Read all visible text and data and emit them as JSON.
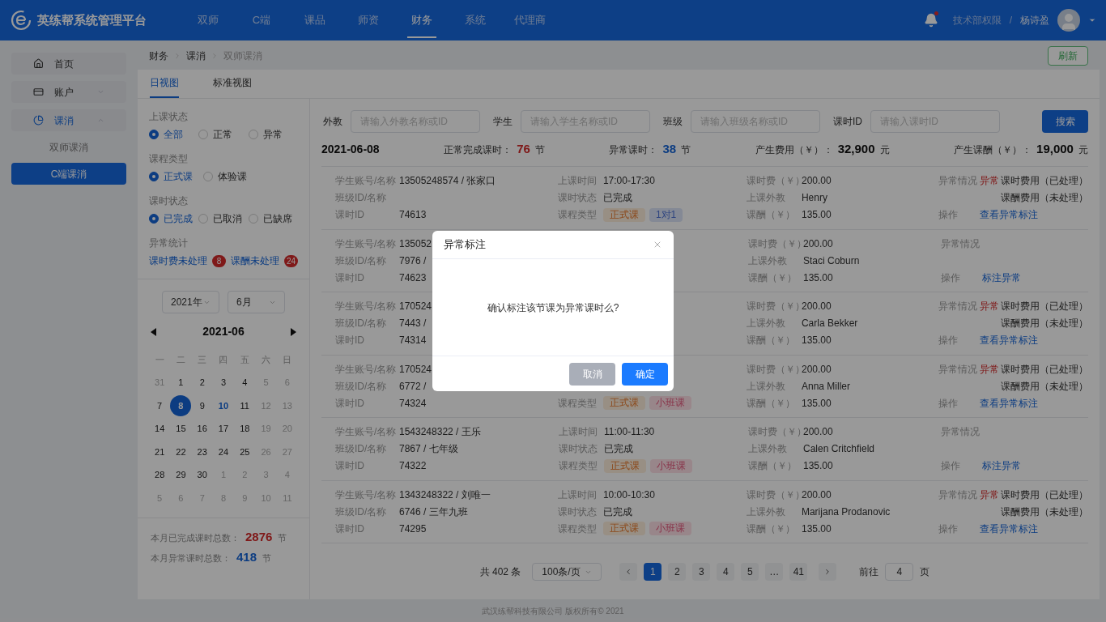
{
  "header": {
    "brand": "英练帮系统管理平台",
    "nav": [
      {
        "label": "双师",
        "selected": false
      },
      {
        "label": "C端",
        "selected": false
      },
      {
        "label": "课品",
        "selected": false
      },
      {
        "label": "师资",
        "selected": false
      },
      {
        "label": "财务",
        "selected": true
      },
      {
        "label": "系统",
        "selected": false
      },
      {
        "label": "代理商",
        "selected": false
      }
    ],
    "notification_dot": true,
    "role": "技术部权限",
    "separator": "/",
    "user": "杨诗盈"
  },
  "sidebar": {
    "items": [
      {
        "label": "首页",
        "selected": false
      },
      {
        "label": "账户",
        "selected": false,
        "expanded": false
      },
      {
        "label": "课消",
        "selected": true,
        "expanded": true,
        "children": [
          {
            "label": "双师课消",
            "selected": false
          },
          {
            "label": "C端课消",
            "selected": true
          }
        ]
      }
    ]
  },
  "breadcrumb": [
    "财务",
    "课消",
    "双师课消"
  ],
  "refresh_button": "刷新",
  "tabs": [
    {
      "label": "日视图",
      "selected": true
    },
    {
      "label": "标准视图",
      "selected": false
    }
  ],
  "filters": [
    {
      "title": "上课状态",
      "options": [
        {
          "label": "全部",
          "selected": true
        },
        {
          "label": "正常",
          "selected": false
        },
        {
          "label": "异常",
          "selected": false
        }
      ]
    },
    {
      "title": "课程类型",
      "options": [
        {
          "label": "正式课",
          "selected": true
        },
        {
          "label": "体验课",
          "selected": false
        }
      ]
    },
    {
      "title": "课时状态",
      "options": [
        {
          "label": "已完成",
          "selected": true
        },
        {
          "label": "已取消",
          "selected": false
        },
        {
          "label": "已缺席",
          "selected": false
        }
      ]
    }
  ],
  "abnormal_stats": {
    "title": "异常统计",
    "links": [
      {
        "label": "课时费未处理",
        "count": "8"
      },
      {
        "label": "课酬未处理",
        "count": "24"
      }
    ]
  },
  "calendar": {
    "year": "2021年",
    "month": "6月",
    "title": "2021-06",
    "weekdays": [
      "一",
      "二",
      "三",
      "四",
      "五",
      "六",
      "日"
    ],
    "days": [
      {
        "d": "31",
        "muted": true,
        "marked": false,
        "selected": false
      },
      {
        "d": "1",
        "muted": false,
        "marked": false,
        "selected": false
      },
      {
        "d": "2",
        "muted": false,
        "marked": false,
        "selected": false
      },
      {
        "d": "3",
        "muted": false,
        "marked": false,
        "selected": false
      },
      {
        "d": "4",
        "muted": false,
        "marked": false,
        "selected": false
      },
      {
        "d": "5",
        "muted": true,
        "marked": false,
        "selected": false
      },
      {
        "d": "6",
        "muted": true,
        "marked": false,
        "selected": false
      },
      {
        "d": "7",
        "muted": false,
        "marked": false,
        "selected": false
      },
      {
        "d": "8",
        "muted": false,
        "marked": false,
        "selected": true
      },
      {
        "d": "9",
        "muted": false,
        "marked": false,
        "selected": false
      },
      {
        "d": "10",
        "muted": false,
        "marked": true,
        "selected": false
      },
      {
        "d": "11",
        "muted": false,
        "marked": false,
        "selected": false
      },
      {
        "d": "12",
        "muted": true,
        "marked": false,
        "selected": false
      },
      {
        "d": "13",
        "muted": true,
        "marked": false,
        "selected": false
      },
      {
        "d": "14",
        "muted": false,
        "marked": false,
        "selected": false
      },
      {
        "d": "15",
        "muted": false,
        "marked": false,
        "selected": false
      },
      {
        "d": "16",
        "muted": false,
        "marked": false,
        "selected": false
      },
      {
        "d": "17",
        "muted": false,
        "marked": false,
        "selected": false
      },
      {
        "d": "18",
        "muted": false,
        "marked": false,
        "selected": false
      },
      {
        "d": "19",
        "muted": true,
        "marked": false,
        "selected": false
      },
      {
        "d": "20",
        "muted": true,
        "marked": false,
        "selected": false
      },
      {
        "d": "21",
        "muted": false,
        "marked": false,
        "selected": false
      },
      {
        "d": "22",
        "muted": false,
        "marked": false,
        "selected": false
      },
      {
        "d": "23",
        "muted": false,
        "marked": false,
        "selected": false
      },
      {
        "d": "24",
        "muted": false,
        "marked": false,
        "selected": false
      },
      {
        "d": "25",
        "muted": false,
        "marked": false,
        "selected": false
      },
      {
        "d": "26",
        "muted": true,
        "marked": false,
        "selected": false
      },
      {
        "d": "27",
        "muted": true,
        "marked": false,
        "selected": false
      },
      {
        "d": "28",
        "muted": false,
        "marked": false,
        "selected": false
      },
      {
        "d": "29",
        "muted": false,
        "marked": false,
        "selected": false
      },
      {
        "d": "30",
        "muted": false,
        "marked": false,
        "selected": false
      },
      {
        "d": "1",
        "muted": true,
        "marked": false,
        "selected": false
      },
      {
        "d": "2",
        "muted": true,
        "marked": false,
        "selected": false
      },
      {
        "d": "3",
        "muted": true,
        "marked": false,
        "selected": false
      },
      {
        "d": "4",
        "muted": true,
        "marked": false,
        "selected": false
      },
      {
        "d": "5",
        "muted": true,
        "marked": false,
        "selected": false
      },
      {
        "d": "6",
        "muted": true,
        "marked": false,
        "selected": false
      },
      {
        "d": "7",
        "muted": true,
        "marked": false,
        "selected": false
      },
      {
        "d": "8",
        "muted": true,
        "marked": false,
        "selected": false
      },
      {
        "d": "9",
        "muted": true,
        "marked": false,
        "selected": false
      },
      {
        "d": "10",
        "muted": true,
        "marked": false,
        "selected": false
      },
      {
        "d": "11",
        "muted": true,
        "marked": false,
        "selected": false
      }
    ]
  },
  "month_stats": [
    {
      "label": "本月已完成课时总数：",
      "value": "2876",
      "unit": "节",
      "kind": "completed"
    },
    {
      "label": "本月异常课时总数：",
      "value": "418",
      "unit": "节",
      "kind": "abnormal"
    }
  ],
  "search": {
    "fields": [
      {
        "label": "外教",
        "placeholder": "请输入外教名称或ID"
      },
      {
        "label": "学生",
        "placeholder": "请输入学生名称或ID"
      },
      {
        "label": "班级",
        "placeholder": "请输入班级名称或ID"
      },
      {
        "label": "课时ID",
        "placeholder": "请输入课时ID"
      }
    ],
    "button": "搜索"
  },
  "date": "2021-06-08",
  "summary": [
    {
      "label": "正常完成课时：",
      "value": "76",
      "unit": "节",
      "kind": "completed"
    },
    {
      "label": "异常课时：",
      "value": "38",
      "unit": "节",
      "kind": "abnormal"
    },
    {
      "label": "产生费用（￥）：",
      "value": "32,900",
      "unit": "元",
      "kind": "money"
    },
    {
      "label": "产生课酬（￥）：",
      "value": "19,000",
      "unit": "元",
      "kind": "money"
    }
  ],
  "records": [
    {
      "col1": [
        {
          "label": "学生账号/名称",
          "value": "13505248574 / 张家口"
        },
        {
          "label": "班级ID/名称"
        },
        {
          "label": "课时ID",
          "value": "74613"
        }
      ],
      "col2": [
        {
          "label": "上课时间",
          "value": "17:00-17:30"
        },
        {
          "label": "课时状态",
          "value": "已完成"
        },
        {
          "label": "课程类型",
          "tags": [
            {
              "text": "正式课",
              "kind": "formal"
            },
            {
              "text": "1对1",
              "kind": "one"
            }
          ]
        }
      ],
      "col3": [
        {
          "label": "课时费（￥）",
          "value": "200.00"
        },
        {
          "label": "上课外教",
          "value": "Henry"
        },
        {
          "label": "课酬（￥）",
          "value": "135.00"
        }
      ],
      "abnormal": {
        "label": "异常情况",
        "flag": "异常",
        "lines": [
          "课时费用（已处理）",
          "课酬费用（未处理）"
        ]
      },
      "action": {
        "label": "操作",
        "link": "查看异常标注"
      }
    },
    {
      "col1": [
        {
          "label": "学生账号/名称",
          "value": "135052"
        },
        {
          "label": "班级ID/名称",
          "value": "7976 /"
        },
        {
          "label": "课时ID",
          "value": "74623"
        }
      ],
      "col3": [
        {
          "label": "课时费（￥）",
          "value": "200.00"
        },
        {
          "label": "上课外教",
          "value": "Staci Coburn"
        },
        {
          "label": "课酬（￥）",
          "value": "135.00"
        }
      ],
      "abnormal": {
        "label": "异常情况"
      },
      "action": {
        "label": "操作",
        "link": "标注异常"
      }
    },
    {
      "col1": [
        {
          "label": "学生账号/名称",
          "value": "170524"
        },
        {
          "label": "班级ID/名称",
          "value": "7443 /"
        },
        {
          "label": "课时ID",
          "value": "74314"
        }
      ],
      "col3": [
        {
          "label": "课时费（￥）",
          "value": "200.00"
        },
        {
          "label": "上课外教",
          "value": "Carla Bekker"
        },
        {
          "label": "课酬（￥）",
          "value": "135.00"
        }
      ],
      "abnormal": {
        "label": "异常情况",
        "flag": "异常",
        "lines": [
          "课时费用（已处理）",
          "课酬费用（未处理）"
        ]
      },
      "action": {
        "label": "操作",
        "link": "查看异常标注"
      }
    },
    {
      "col1": [
        {
          "label": "学生账号/名称",
          "value": "170524"
        },
        {
          "label": "班级ID/名称",
          "value": "6772 /"
        },
        {
          "label": "课时ID",
          "value": "74324"
        }
      ],
      "course_type": {
        "label": "课程类型",
        "tags": [
          {
            "text": "正式课",
            "kind": "formal"
          },
          {
            "text": "小班课",
            "kind": "small"
          }
        ]
      },
      "col3": [
        {
          "label": "课时费（￥）",
          "value": "200.00"
        },
        {
          "label": "上课外教",
          "value": "Anna Miller"
        },
        {
          "label": "课酬（￥）",
          "value": "135.00"
        }
      ],
      "abnormal": {
        "label": "异常情况",
        "flag": "异常",
        "lines": [
          "课时费用（已处理）",
          "课酬费用（未处理）"
        ]
      },
      "action": {
        "label": "操作",
        "link": "查看异常标注"
      }
    },
    {
      "col1": [
        {
          "label": "学生账号/名称",
          "value": "1543248322 / 王乐"
        },
        {
          "label": "班级ID/名称",
          "value": "7867 / 七年级"
        },
        {
          "label": "课时ID",
          "value": "74322"
        }
      ],
      "col2": [
        {
          "label": "上课时间",
          "value": "11:00-11:30"
        },
        {
          "label": "课时状态",
          "value": "已完成"
        },
        {
          "label": "课程类型",
          "tags": [
            {
              "text": "正式课",
              "kind": "formal"
            },
            {
              "text": "小班课",
              "kind": "small"
            }
          ]
        }
      ],
      "col3": [
        {
          "label": "课时费（￥）",
          "value": "200.00"
        },
        {
          "label": "上课外教",
          "value": "Calen Critchfield"
        },
        {
          "label": "课酬（￥）",
          "value": "135.00"
        }
      ],
      "abnormal": {
        "label": "异常情况"
      },
      "action": {
        "label": "操作",
        "link": "标注异常"
      }
    },
    {
      "col1": [
        {
          "label": "学生账号/名称",
          "value": "1343248322 / 刘唯一"
        },
        {
          "label": "班级ID/名称",
          "value": "6746 / 三年九班"
        },
        {
          "label": "课时ID",
          "value": "74295"
        }
      ],
      "col2": [
        {
          "label": "上课时间",
          "value": "10:00-10:30"
        },
        {
          "label": "课时状态",
          "value": "已完成"
        },
        {
          "label": "课程类型",
          "tags": [
            {
              "text": "正式课",
              "kind": "formal"
            },
            {
              "text": "小班课",
              "kind": "small"
            }
          ]
        }
      ],
      "col3": [
        {
          "label": "课时费（￥）",
          "value": "200.00"
        },
        {
          "label": "上课外教",
          "value": "Marijana Prodanovic"
        },
        {
          "label": "课酬（￥）",
          "value": "135.00"
        }
      ],
      "abnormal": {
        "label": "异常情况",
        "flag": "异常",
        "lines": [
          "课时费用（已处理）",
          "课酬费用（未处理）"
        ]
      },
      "action": {
        "label": "操作",
        "link": "查看异常标注"
      }
    }
  ],
  "pagination": {
    "total": "共 402 条",
    "page_size": "100条/页",
    "pages": [
      {
        "label": "1",
        "selected": true
      },
      {
        "label": "2",
        "selected": false
      },
      {
        "label": "3",
        "selected": false
      },
      {
        "label": "4",
        "selected": false
      },
      {
        "label": "5",
        "selected": false
      },
      {
        "label": "…",
        "selected": false
      },
      {
        "label": "41",
        "selected": false
      }
    ],
    "goto_label": "前往",
    "goto_value": "4",
    "goto_unit": "页"
  },
  "footer": "武汉练帮科技有限公司 版权所有© 2021",
  "modal": {
    "title": "异常标注",
    "message": "确认标注该节课为异常课时么?",
    "cancel": "取消",
    "confirm": "确定"
  }
}
